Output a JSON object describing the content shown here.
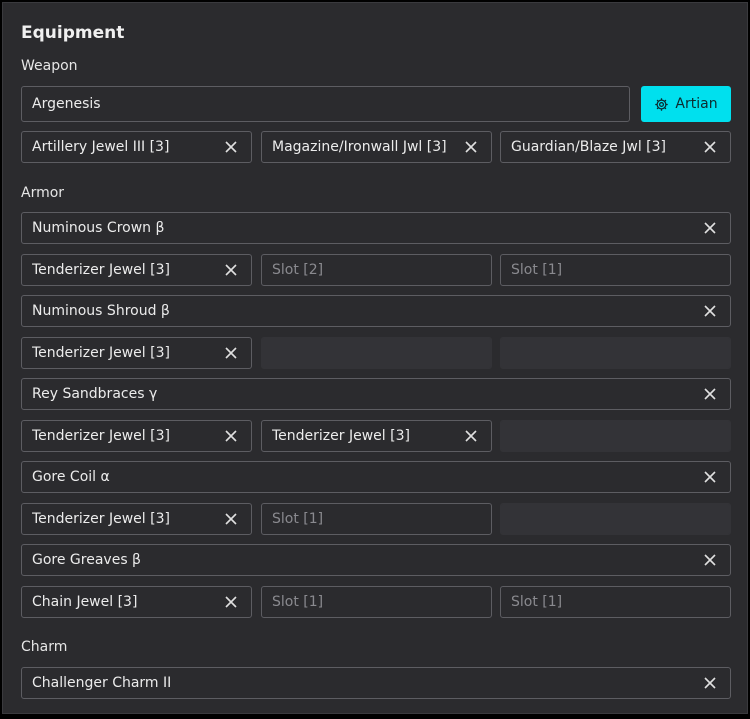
{
  "title": "Equipment",
  "weapon": {
    "section_label": "Weapon",
    "name": "Argenesis",
    "artian_label": "Artian",
    "jewels": [
      "Artillery Jewel III [3]",
      "Magazine/Ironwall Jwl [3]",
      "Guardian/Blaze Jwl [3]"
    ]
  },
  "armor": {
    "section_label": "Armor",
    "pieces": [
      {
        "name": "Numinous Crown β",
        "slots": [
          "Tenderizer Jewel [3]",
          "Slot [2]",
          "Slot [1]"
        ]
      },
      {
        "name": "Numinous Shroud β",
        "slots": [
          "Tenderizer Jewel [3]",
          "",
          ""
        ]
      },
      {
        "name": "Rey Sandbraces γ",
        "slots": [
          "Tenderizer Jewel [3]",
          "Tenderizer Jewel [3]",
          ""
        ]
      },
      {
        "name": "Gore Coil α",
        "slots": [
          "Tenderizer Jewel [3]",
          "Slot [1]",
          ""
        ]
      },
      {
        "name": "Gore Greaves β",
        "slots": [
          "Chain Jewel [3]",
          "Slot [1]",
          "Slot [1]"
        ]
      }
    ]
  },
  "charm": {
    "section_label": "Charm",
    "name": "Challenger Charm II"
  },
  "icons": {
    "remove": "close-icon",
    "artian": "gear-icon"
  }
}
